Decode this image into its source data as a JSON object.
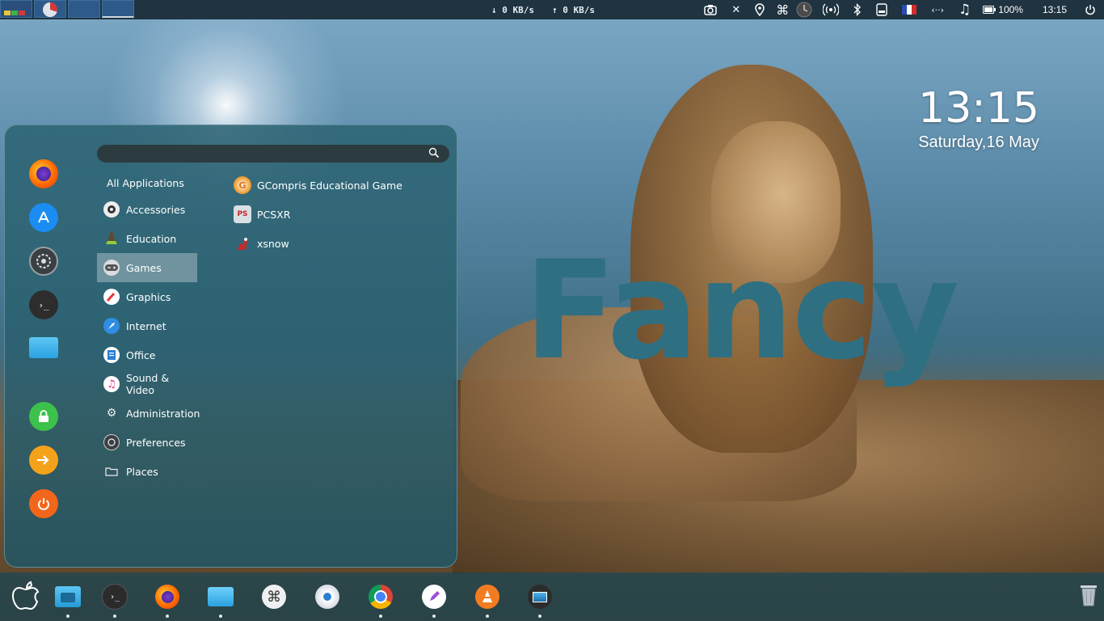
{
  "top_panel": {
    "net_down": "↓ 0 KB/s",
    "net_up": "↑ 0 KB/s",
    "battery": "100%",
    "time": "13:15"
  },
  "desktop": {
    "brand_text": "Fancy",
    "clock_time": "13:15",
    "clock_date": "Saturday,16 May"
  },
  "menu": {
    "search_placeholder": "",
    "all_applications": "All Applications",
    "categories": [
      {
        "label": "Accessories",
        "icon": "gear-icon"
      },
      {
        "label": "Education",
        "icon": "flask-icon"
      },
      {
        "label": "Games",
        "icon": "gamepad-icon",
        "selected": true
      },
      {
        "label": "Graphics",
        "icon": "brush-icon"
      },
      {
        "label": "Internet",
        "icon": "compass-icon"
      },
      {
        "label": "Office",
        "icon": "document-icon"
      },
      {
        "label": "Sound & Video",
        "icon": "music-icon"
      },
      {
        "label": "Administration",
        "icon": "cogs-icon"
      },
      {
        "label": "Preferences",
        "icon": "settings-icon"
      },
      {
        "label": "Places",
        "icon": "folder-icon"
      }
    ],
    "apps": [
      {
        "label": "GCompris Educational Game",
        "icon": "gcompris-icon"
      },
      {
        "label": "PCSXR",
        "icon": "pcsxr-icon"
      },
      {
        "label": "xsnow",
        "icon": "xsnow-icon"
      }
    ],
    "favorites": [
      "firefox-icon",
      "app-store-icon",
      "system-settings-icon",
      "terminal-icon",
      "folder-icon"
    ],
    "session": [
      "lock-icon",
      "logout-icon",
      "power-icon"
    ]
  },
  "dock": {
    "items": [
      "apple-icon",
      "files-icon",
      "terminal-icon",
      "firefox-icon",
      "folder-icon",
      "command-icon",
      "disk-icon",
      "chrome-icon",
      "text-editor-icon",
      "vlc-icon",
      "screenshot-icon",
      "trash-icon"
    ]
  },
  "colors": {
    "panel": "#1f3340",
    "menu_bg": "#2d6473",
    "brand": "#2f6f82",
    "selection": "#9fb4ba"
  }
}
